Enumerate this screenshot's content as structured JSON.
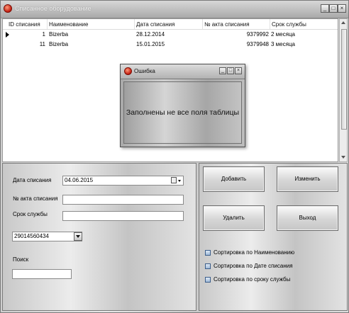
{
  "window": {
    "title": "Списанное оборудование",
    "controls": {
      "minimize": "_",
      "maximize": "□",
      "close": "×"
    }
  },
  "grid": {
    "columns": [
      "ID списания",
      "Наименование",
      "Дата списания",
      "№ акта списания",
      "Срок службы"
    ],
    "rows": [
      {
        "id": "1",
        "name": "Bizerba",
        "date": "28.12.2014",
        "act": "9379992",
        "term": "2 месяца"
      },
      {
        "id": "11",
        "name": "Bizerba",
        "date": "15.01.2015",
        "act": "9379948",
        "term": "3 месяца"
      }
    ]
  },
  "form": {
    "date_label": "Дата списания",
    "date_value": "04.06.2015",
    "act_label": "№ акта списания",
    "act_value": "",
    "term_label": "Срок службы",
    "term_value": "",
    "combo_value": "29014560434",
    "search_label": "Поиск",
    "search_value": ""
  },
  "buttons": {
    "add": "Добавить",
    "edit": "Изменить",
    "delete": "Удалить",
    "exit": "Выход"
  },
  "sort_options": [
    "Сортировка по Наименованию",
    "Сортировка по Дате списания",
    "Сортировка по сроку службы"
  ],
  "dialog": {
    "title": "Ошибка",
    "message": "Заполнены не все поля таблицы"
  }
}
